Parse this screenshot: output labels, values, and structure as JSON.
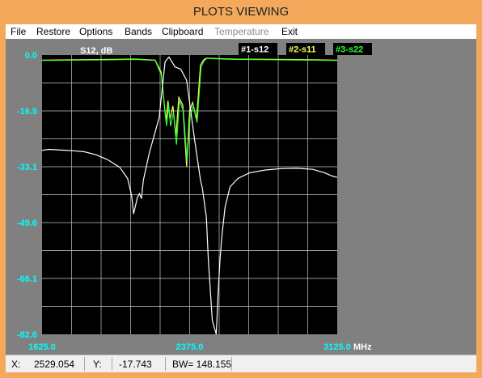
{
  "window": {
    "title": "PLOTS VIEWING"
  },
  "menu": [
    "File",
    "Restore",
    "Options",
    "Bands",
    "Clipboard",
    "Temperature",
    "Exit"
  ],
  "menu_disabled": [
    "Temperature"
  ],
  "colors": {
    "frame": "#f3a85c",
    "plot_background": "#000000",
    "grid": "#c8c8c8",
    "axis_labels": "#00ffff",
    "s12": "#ffffff",
    "s11": "#ffff60",
    "s22": "#30ff30"
  },
  "chart_data": {
    "type": "line",
    "title": "S12, dB",
    "x_unit": "MHz",
    "xlim": [
      1625.0,
      3125.0
    ],
    "ylim": [
      -82.6,
      0.0
    ],
    "x_tick_labels": [
      "1625.0",
      "2375.0",
      "3125.0"
    ],
    "y_tick_labels": [
      "0.0",
      "-16.5",
      "-33.1",
      "-49.6",
      "-66.1",
      "-82.6"
    ],
    "grid": true,
    "legend_position": "top-right",
    "series": [
      {
        "name": "#1-s12",
        "x": [
          1625,
          1660,
          1720,
          1780,
          1840,
          1900,
          1960,
          2020,
          2060,
          2080,
          2090,
          2110,
          2120,
          2130,
          2140,
          2170,
          2220,
          2250,
          2270,
          2285,
          2300,
          2330,
          2360,
          2400,
          2430,
          2440,
          2460,
          2470,
          2490,
          2510,
          2520,
          2530,
          2540,
          2555,
          2580,
          2620,
          2680,
          2760,
          2840,
          2920,
          3000,
          3060,
          3100,
          3125
        ],
        "y": [
          -28.2,
          -27.9,
          -28.1,
          -28.3,
          -28.6,
          -29.5,
          -31.0,
          -33.2,
          -36.5,
          -41.5,
          -47.0,
          -42.0,
          -41.0,
          -42.5,
          -37.0,
          -29.0,
          -18.5,
          -2.0,
          -0.6,
          -2.0,
          -3.5,
          -4.2,
          -7.5,
          -25.0,
          -37.0,
          -39.5,
          -48.0,
          -60.5,
          -78.5,
          -82.6,
          -70.0,
          -60.0,
          -53.0,
          -45.0,
          -39.0,
          -36.5,
          -34.8,
          -34.0,
          -33.6,
          -33.5,
          -33.8,
          -34.8,
          -35.8,
          -36.2
        ]
      },
      {
        "name": "#2-s11",
        "x": [
          1625,
          1800,
          2000,
          2100,
          2200,
          2230,
          2245,
          2255,
          2265,
          2275,
          2290,
          2305,
          2320,
          2340,
          2360,
          2375,
          2390,
          2410,
          2430,
          2445,
          2460,
          2500,
          2600,
          2800,
          3000,
          3125
        ],
        "y": [
          -1.5,
          -1.4,
          -1.3,
          -1.2,
          -1.5,
          -5.0,
          -14.0,
          -19.5,
          -13.5,
          -19.0,
          -15.0,
          -24.0,
          -12.5,
          -14.8,
          -33.0,
          -16.5,
          -14.0,
          -19.0,
          -3.0,
          -1.5,
          -0.9,
          -1.0,
          -1.2,
          -1.3,
          -1.4,
          -1.5
        ]
      },
      {
        "name": "#3-s22",
        "x": [
          1625,
          1800,
          2000,
          2100,
          2200,
          2232,
          2248,
          2258,
          2268,
          2278,
          2293,
          2308,
          2323,
          2343,
          2362,
          2378,
          2393,
          2413,
          2433,
          2448,
          2463,
          2500,
          2600,
          2800,
          3000,
          3125
        ],
        "y": [
          -1.6,
          -1.5,
          -1.4,
          -1.3,
          -1.6,
          -6.0,
          -16.0,
          -21.0,
          -14.5,
          -21.0,
          -17.0,
          -26.5,
          -13.5,
          -16.5,
          -31.5,
          -18.0,
          -15.0,
          -20.0,
          -3.5,
          -1.7,
          -1.0,
          -1.1,
          -1.3,
          -1.4,
          -1.5,
          -1.6
        ]
      }
    ]
  },
  "status": {
    "x_label": "X:",
    "x_value": "2529.054",
    "y_label": "Y:",
    "y_value": "-17.743",
    "bw_text": "BW= 148.155"
  }
}
